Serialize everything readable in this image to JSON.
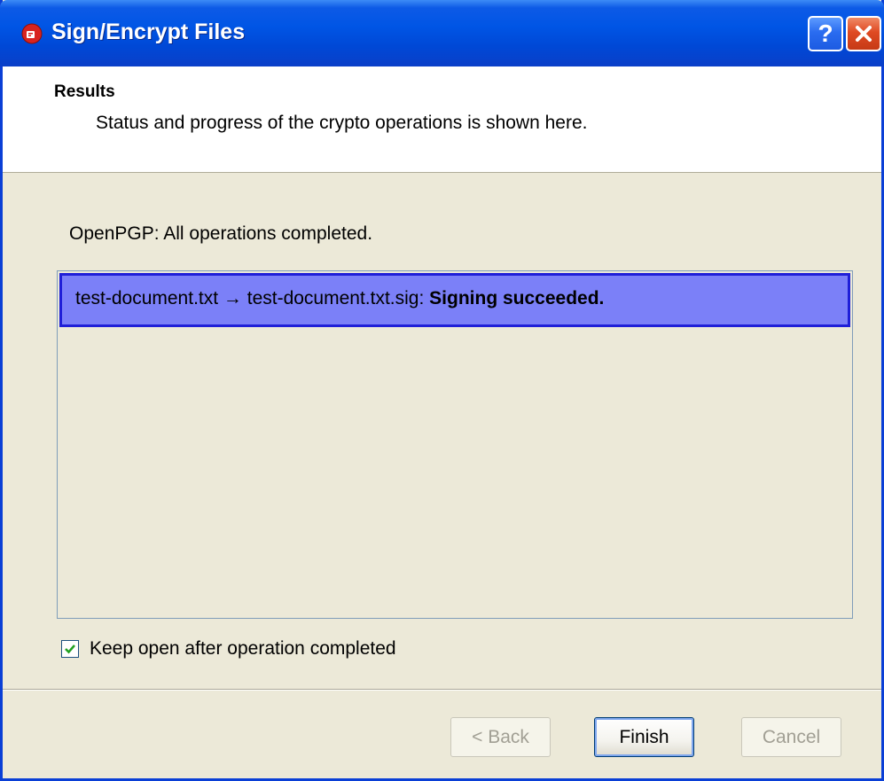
{
  "window": {
    "title": "Sign/Encrypt Files"
  },
  "header": {
    "title": "Results",
    "subtitle": "Status and progress of the crypto operations is shown here."
  },
  "status": {
    "text": "OpenPGP: All operations completed."
  },
  "results": [
    {
      "file": "test-document.txt → test-document.txt.sig: ",
      "status": "Signing succeeded."
    }
  ],
  "options": {
    "keep_open_label": "Keep open after operation completed",
    "keep_open_checked": true
  },
  "buttons": {
    "back": "< Back",
    "finish": "Finish",
    "cancel": "Cancel"
  },
  "icons": {
    "app": "kleopatra-app-icon",
    "help": "help-icon",
    "close": "close-icon",
    "check": "checkmark-icon"
  },
  "colors": {
    "titlebar": "#0055e5",
    "selection": "#7b80f8",
    "close_button": "#df4a23"
  }
}
